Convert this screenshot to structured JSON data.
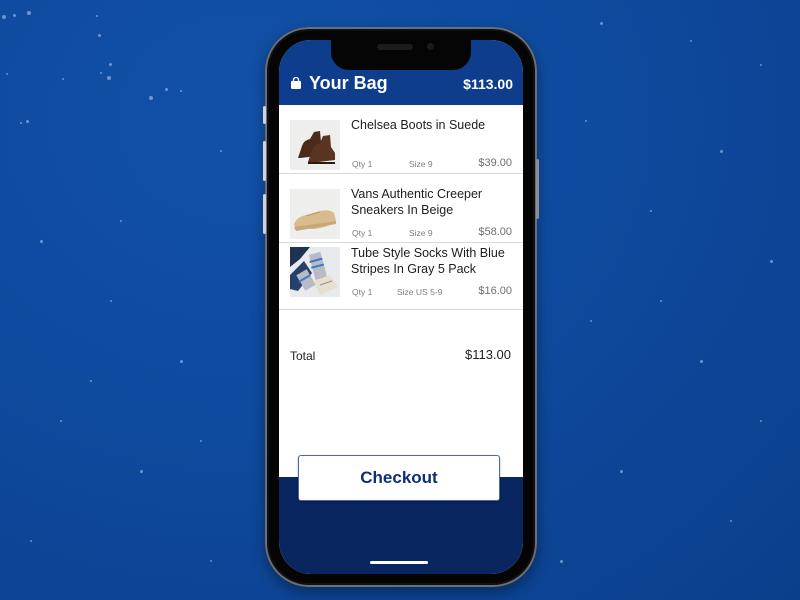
{
  "header": {
    "icon": "shopping-bag-icon",
    "title": "Your Bag",
    "total": "$113.00"
  },
  "items": [
    {
      "name": "Chelsea Boots in Suede",
      "qty": "Qty 1",
      "size": "Size 9",
      "price": "$39.00",
      "image": "brown-chelsea-boots"
    },
    {
      "name": "Vans Authentic Creeper Sneakers In Beige",
      "qty": "Qty 1",
      "size": "Size 9",
      "price": "$58.00",
      "image": "beige-creeper-sneakers"
    },
    {
      "name": "Tube Style Socks With Blue Stripes In Gray 5 Pack",
      "qty": "Qty 1",
      "size": "Size US 5-9",
      "price": "$16.00",
      "image": "gray-striped-tube-socks"
    }
  ],
  "summary": {
    "total_label": "Total",
    "total_value": "$113.00"
  },
  "checkout": {
    "label": "Checkout"
  },
  "colors": {
    "brand_blue": "#0e3d8e",
    "background_blue": "#0e4a9e",
    "bottom_panel": "#0a2660",
    "button_text": "#0e2e7a"
  }
}
